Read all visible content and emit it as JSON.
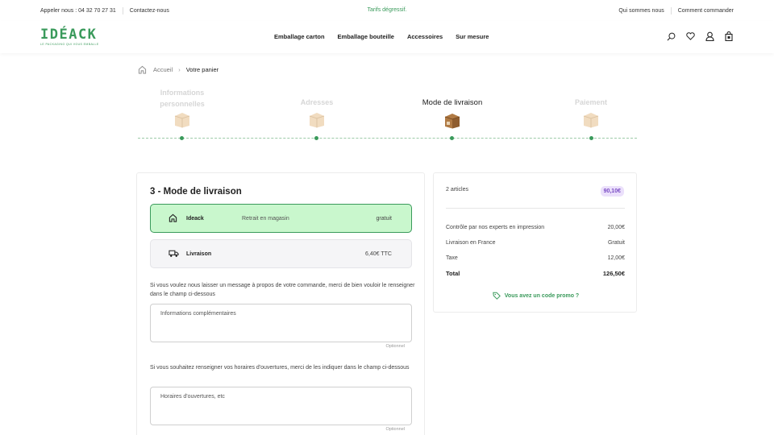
{
  "topbar": {
    "phone": "Appeler nous : 04 32 70 27 31",
    "contact": "Contactez-nous",
    "promo": "Tarifs dégressif.",
    "about": "Qui sommes nous",
    "how_to_order": "Comment commander"
  },
  "header": {
    "logo": "IDÉACK",
    "logo_tagline": "LE PACKAGING QUI VOUS EMBALLE",
    "nav": [
      "Emballage carton",
      "Emballage bouteille",
      "Accessoires",
      "Sur mesure"
    ],
    "icons": [
      "search-icon",
      "heart-icon",
      "user-icon",
      "cart-icon"
    ]
  },
  "breadcrumb": {
    "home": "Accueil",
    "current": "Votre panier"
  },
  "steps": [
    {
      "label": "Informations personnelles",
      "active": false
    },
    {
      "label": "Adresses",
      "active": false
    },
    {
      "label": "Mode de livraison",
      "active": true
    },
    {
      "label": "Paiement",
      "active": false
    }
  ],
  "delivery": {
    "title": "3 - Mode de livraison",
    "options": [
      {
        "name": "Ideack",
        "description": "Retrait en magasin",
        "price": "gratuit",
        "selected": true,
        "icon": "home-icon"
      },
      {
        "name": "Livraison",
        "description": "",
        "price": "6,40€ TTC",
        "selected": false,
        "icon": "truck-icon"
      }
    ],
    "message_help": "Si vous voulez nous laisser un message à propos de votre commande, merci de bien vouloir le renseigner dans le champ ci-dessous",
    "message_placeholder": "Informations complémentaires",
    "optional_label": "Optionnel",
    "hours_help": "Si vous souhaitez renseigner vos horaires d'ouvertures, merci de les indiquer dans le champ ci-dessous",
    "hours_placeholder": "Horaires d'ouvertures, etc"
  },
  "summary": {
    "articles": "2 articles",
    "articles_total": "90,10€",
    "rows": [
      {
        "label": "Contrôle par nos experts en impression",
        "value": "20,00€"
      },
      {
        "label": "Livraison en France",
        "value": "Gratuit"
      },
      {
        "label": "Taxe",
        "value": "12,00€"
      }
    ],
    "total_label": "Total",
    "total_value": "126,50€",
    "promo_link": "Vous avez un code promo ?"
  },
  "colors": {
    "brand_green": "#3a9a5b",
    "selected_bg": "#c9f7cd",
    "badge_bg": "#ebe0fb",
    "badge_text": "#7a4cc4"
  }
}
